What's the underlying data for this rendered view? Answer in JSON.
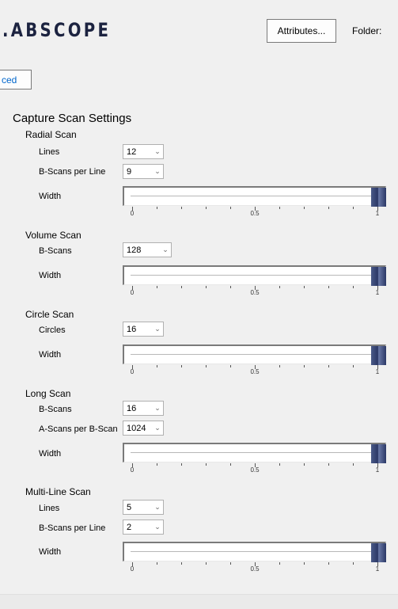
{
  "header": {
    "logo": ".ABSCOPE",
    "attributes_button": "Attributes...",
    "folder_label": "Folder:",
    "advanced_button": "ced"
  },
  "panel": {
    "title": "Capture Scan Settings",
    "slider_ticks": {
      "min": "0",
      "mid": "0.5",
      "max": "1"
    },
    "width_label": "Width",
    "groups": {
      "radial": {
        "title": "Radial Scan",
        "lines_label": "Lines",
        "lines_value": "12",
        "bscans_label": "B-Scans per Line",
        "bscans_value": "9",
        "width_value": 1.0
      },
      "volume": {
        "title": "Volume Scan",
        "bscans_label": "B-Scans",
        "bscans_value": "128",
        "width_value": 1.0
      },
      "circle": {
        "title": "Circle Scan",
        "circles_label": "Circles",
        "circles_value": "16",
        "width_value": 1.0
      },
      "long": {
        "title": "Long Scan",
        "bscans_label": "B-Scans",
        "bscans_value": "16",
        "ascans_label": "A-Scans per B-Scan",
        "ascans_value": "1024",
        "width_value": 1.0
      },
      "multiline": {
        "title": "Multi-Line Scan",
        "lines_label": "Lines",
        "lines_value": "5",
        "bscans_label": "B-Scans per Line",
        "bscans_value": "2",
        "width_value": 1.0
      }
    }
  },
  "icons": {
    "dropdown": "chevron-down-icon"
  }
}
